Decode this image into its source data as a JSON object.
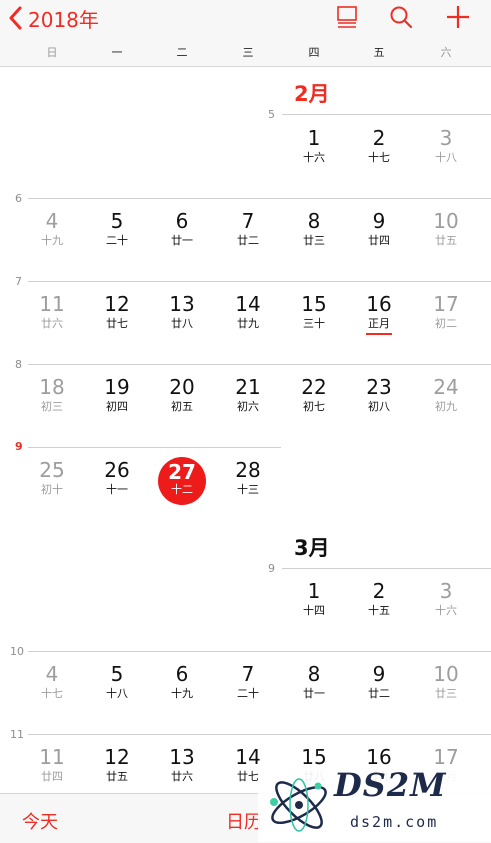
{
  "header": {
    "back_label": "2018年",
    "colors": {
      "accent": "#ee2d24",
      "today_circle": "#ee1b1b"
    },
    "icons": [
      "chevron-left-icon",
      "list-view-icon",
      "search-icon",
      "add-icon"
    ]
  },
  "weekdays": [
    "日",
    "一",
    "二",
    "三",
    "四",
    "五",
    "六"
  ],
  "week_numbers": {
    "w5": "5",
    "w6": "6",
    "w7": "7",
    "w8": "8",
    "w9": "9",
    "w9b": "9",
    "w10": "10",
    "w11": "11"
  },
  "feb": {
    "title": "2月",
    "days": [
      {
        "n": "1",
        "l": "十六"
      },
      {
        "n": "2",
        "l": "十七"
      },
      {
        "n": "3",
        "l": "十八"
      },
      {
        "n": "4",
        "l": "十九"
      },
      {
        "n": "5",
        "l": "二十"
      },
      {
        "n": "6",
        "l": "廿一"
      },
      {
        "n": "7",
        "l": "廿二"
      },
      {
        "n": "8",
        "l": "廿三"
      },
      {
        "n": "9",
        "l": "廿四"
      },
      {
        "n": "10",
        "l": "廿五"
      },
      {
        "n": "11",
        "l": "廿六"
      },
      {
        "n": "12",
        "l": "廿七"
      },
      {
        "n": "13",
        "l": "廿八"
      },
      {
        "n": "14",
        "l": "廿九"
      },
      {
        "n": "15",
        "l": "三十"
      },
      {
        "n": "16",
        "l": "正月"
      },
      {
        "n": "17",
        "l": "初二"
      },
      {
        "n": "18",
        "l": "初三"
      },
      {
        "n": "19",
        "l": "初四"
      },
      {
        "n": "20",
        "l": "初五"
      },
      {
        "n": "21",
        "l": "初六"
      },
      {
        "n": "22",
        "l": "初七"
      },
      {
        "n": "23",
        "l": "初八"
      },
      {
        "n": "24",
        "l": "初九"
      },
      {
        "n": "25",
        "l": "初十"
      },
      {
        "n": "26",
        "l": "十一"
      },
      {
        "n": "27",
        "l": "十二"
      },
      {
        "n": "28",
        "l": "十三"
      }
    ]
  },
  "mar": {
    "title": "3月",
    "days": [
      {
        "n": "1",
        "l": "十四"
      },
      {
        "n": "2",
        "l": "十五"
      },
      {
        "n": "3",
        "l": "十六"
      },
      {
        "n": "4",
        "l": "十七"
      },
      {
        "n": "5",
        "l": "十八"
      },
      {
        "n": "6",
        "l": "十九"
      },
      {
        "n": "7",
        "l": "二十"
      },
      {
        "n": "8",
        "l": "廿一"
      },
      {
        "n": "9",
        "l": "廿二"
      },
      {
        "n": "10",
        "l": "廿三"
      },
      {
        "n": "11",
        "l": "廿四"
      },
      {
        "n": "12",
        "l": "廿五"
      },
      {
        "n": "13",
        "l": "廿六"
      },
      {
        "n": "14",
        "l": "廿七"
      },
      {
        "n": "15",
        "l": "廿八"
      },
      {
        "n": "16",
        "l": "廿九"
      },
      {
        "n": "17",
        "l": "二月"
      }
    ]
  },
  "toolbar": {
    "today_label": "今天",
    "calendars_label": "日历"
  },
  "watermark": {
    "brand": "DS2M",
    "site": "ds2m.com"
  }
}
